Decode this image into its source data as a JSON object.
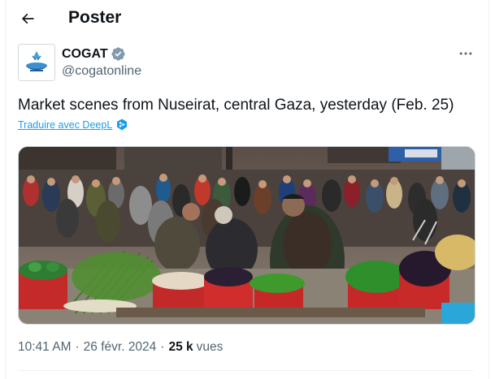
{
  "header": {
    "title": "Poster",
    "back_icon": "arrow-left-icon"
  },
  "author": {
    "display_name": "COGAT",
    "handle": "@cogatonline",
    "verified": true,
    "verified_color": "#829aab",
    "avatar_icon": "cogat-logo-icon"
  },
  "tweet": {
    "text": "Market scenes from Nuseirat, central Gaza, yesterday (Feb. 25)",
    "translate_label": "Traduire avec DeepL",
    "translate_icon": "deepl-icon"
  },
  "media": {
    "type": "photo",
    "subject": "outdoor market scene"
  },
  "meta": {
    "time": "10:41 AM",
    "separator": "·",
    "date": "26 févr. 2024",
    "views_count": "25 k",
    "views_label": "vues"
  },
  "colors": {
    "accent": "#1d9bf0",
    "secondary_text": "#536471",
    "primary_text": "#0f1419"
  }
}
